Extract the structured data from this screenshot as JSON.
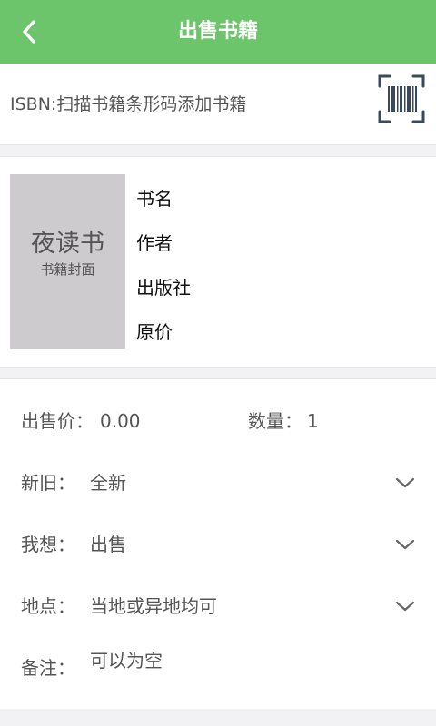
{
  "topbar": {
    "title": "出售书籍"
  },
  "isbn": {
    "placeholder": "ISBN:扫描书籍条形码添加书籍"
  },
  "book": {
    "cover_brand": "夜读书",
    "cover_caption": "书籍封面",
    "title_label": "书名",
    "author_label": "作者",
    "publisher_label": "出版社",
    "original_price_label": "原价"
  },
  "form": {
    "sale_price_label": "出售价：",
    "sale_price_value": "0.00",
    "quantity_label": "数量：",
    "quantity_value": "1",
    "condition_label": "新旧：",
    "condition_value": "全新",
    "intent_label": "我想：",
    "intent_value": "出售",
    "location_label": "地点：",
    "location_value": "当地或异地均可",
    "note_label": "备注：",
    "note_placeholder": "可以为空"
  },
  "colors": {
    "accent": "#6cc56a",
    "cover_bg": "#cdcbce",
    "scan_icon": "#3a4a5c"
  },
  "icons": [
    "back-arrow-icon",
    "barcode-scan-icon",
    "chevron-down-icon"
  ]
}
